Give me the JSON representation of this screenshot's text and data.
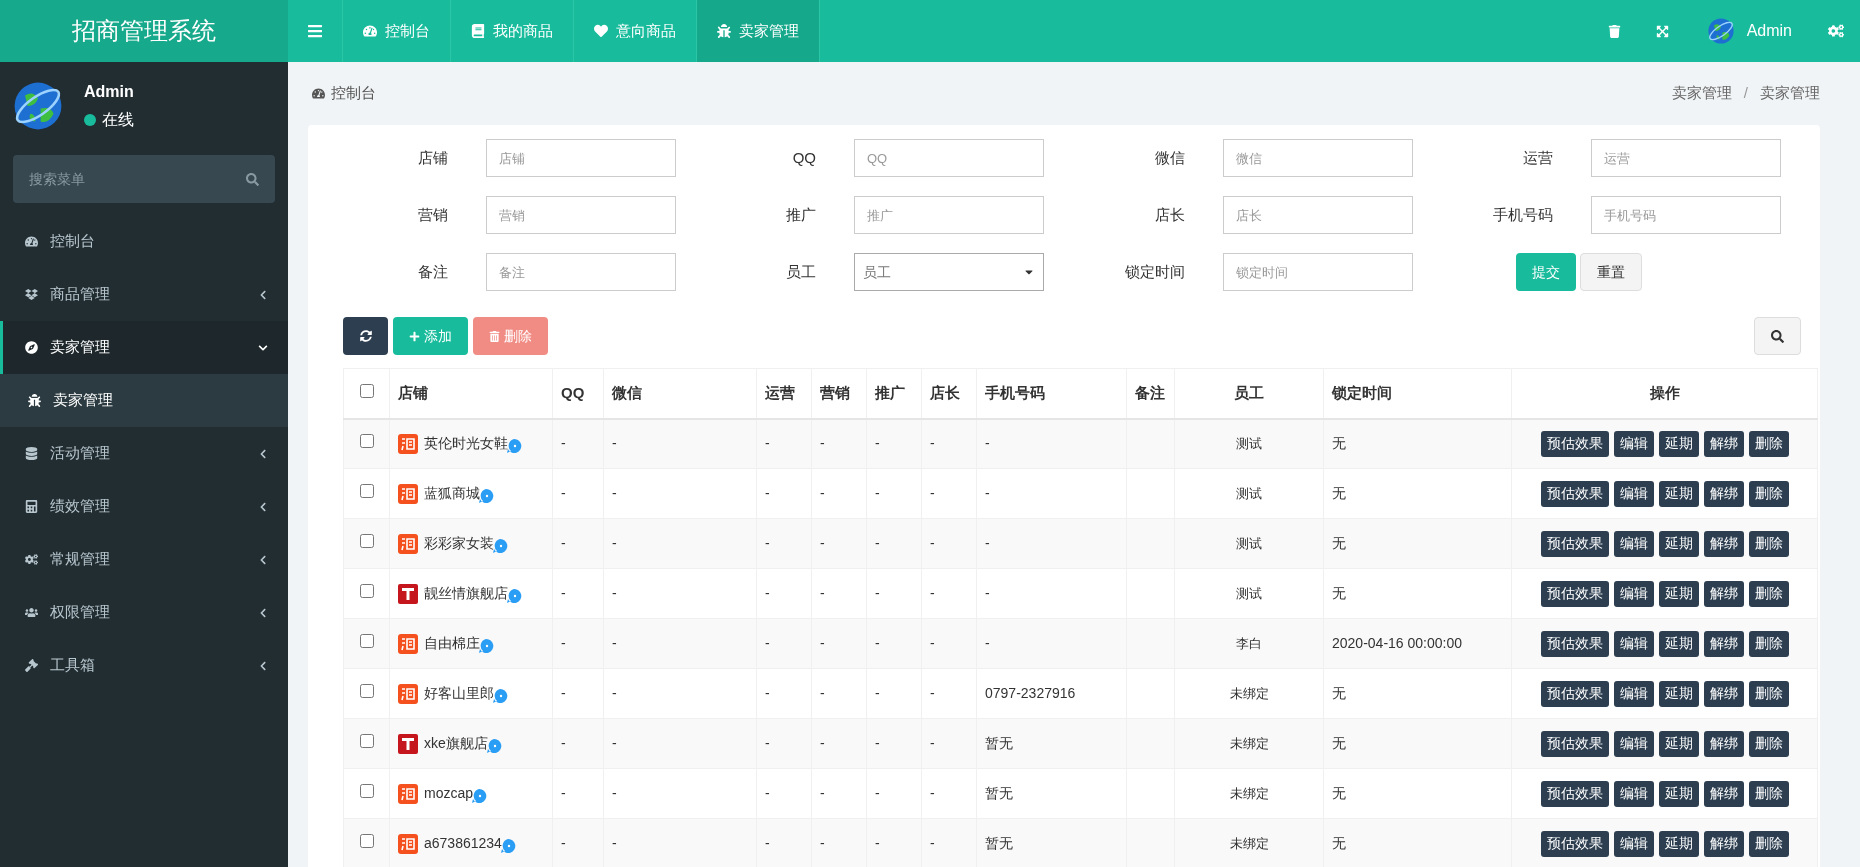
{
  "header": {
    "brand": "招商管理系统",
    "nav_tabs": [
      {
        "label": "控制台",
        "selected": false
      },
      {
        "label": "我的商品",
        "selected": false
      },
      {
        "label": "意向商品",
        "selected": false
      },
      {
        "label": "卖家管理",
        "selected": true
      }
    ],
    "user_name": "Admin"
  },
  "sidebar": {
    "user": {
      "name": "Admin",
      "status": "在线",
      "online": true
    },
    "search": {
      "placeholder": "搜索菜单"
    },
    "menu": [
      {
        "label": "控制台",
        "kind": "link",
        "selected": false
      },
      {
        "label": "商品管理",
        "kind": "group",
        "expanded": false,
        "selected": false
      },
      {
        "label": "卖家管理",
        "kind": "group",
        "expanded": true,
        "selected": true,
        "children": [
          {
            "label": "卖家管理",
            "selected": true
          }
        ]
      },
      {
        "label": "活动管理",
        "kind": "group",
        "expanded": false,
        "selected": false
      },
      {
        "label": "绩效管理",
        "kind": "group",
        "expanded": false,
        "selected": false
      },
      {
        "label": "常规管理",
        "kind": "group",
        "expanded": false,
        "selected": false
      },
      {
        "label": "权限管理",
        "kind": "group",
        "expanded": false,
        "selected": false
      },
      {
        "label": "工具箱",
        "kind": "group",
        "expanded": false,
        "selected": false
      }
    ]
  },
  "page": {
    "title": "控制台",
    "breadcrumb": [
      "卖家管理",
      "卖家管理"
    ],
    "breadcrumb_separator": "/"
  },
  "filters": {
    "fields": [
      {
        "label": "店铺",
        "placeholder": "店铺",
        "kind": "text"
      },
      {
        "label": "QQ",
        "placeholder": "QQ",
        "kind": "text"
      },
      {
        "label": "微信",
        "placeholder": "微信",
        "kind": "text"
      },
      {
        "label": "运营",
        "placeholder": "运营",
        "kind": "text"
      },
      {
        "label": "营销",
        "placeholder": "营销",
        "kind": "text"
      },
      {
        "label": "推广",
        "placeholder": "推广",
        "kind": "text"
      },
      {
        "label": "店长",
        "placeholder": "店长",
        "kind": "text"
      },
      {
        "label": "手机号码",
        "placeholder": "手机号码",
        "kind": "text"
      },
      {
        "label": "备注",
        "placeholder": "备注",
        "kind": "text"
      },
      {
        "label": "员工",
        "placeholder": "员工",
        "kind": "select"
      },
      {
        "label": "锁定时间",
        "placeholder": "锁定时间",
        "kind": "text"
      }
    ],
    "submit": "提交",
    "reset": "重置"
  },
  "toolbar": {
    "add": "添加",
    "delete": "删除"
  },
  "table": {
    "select_all": false,
    "columns": [
      "店铺",
      "QQ",
      "微信",
      "运营",
      "营销",
      "推广",
      "店长",
      "手机号码",
      "备注",
      "员工",
      "锁定时间",
      "操作"
    ],
    "rows": [
      {
        "checked": false,
        "kind": "taobao",
        "cells": [
          "英伦时光女鞋",
          "-",
          "-",
          "-",
          "-",
          "-",
          "-",
          "-",
          "",
          "测试",
          "无"
        ],
        "actions": [
          "预估效果",
          "编辑",
          "延期",
          "解绑",
          "删除"
        ]
      },
      {
        "checked": false,
        "kind": "taobao",
        "cells": [
          "蓝狐商城",
          "-",
          "-",
          "-",
          "-",
          "-",
          "-",
          "-",
          "",
          "测试",
          "无"
        ],
        "actions": [
          "预估效果",
          "编辑",
          "延期",
          "解绑",
          "删除"
        ]
      },
      {
        "checked": false,
        "kind": "taobao",
        "cells": [
          "彩彩家女装",
          "-",
          "-",
          "-",
          "-",
          "-",
          "-",
          "-",
          "",
          "测试",
          "无"
        ],
        "actions": [
          "预估效果",
          "编辑",
          "延期",
          "解绑",
          "删除"
        ]
      },
      {
        "checked": false,
        "kind": "tmall",
        "cells": [
          "靓丝情旗舰店",
          "-",
          "-",
          "-",
          "-",
          "-",
          "-",
          "-",
          "",
          "测试",
          "无"
        ],
        "actions": [
          "预估效果",
          "编辑",
          "延期",
          "解绑",
          "删除"
        ]
      },
      {
        "checked": false,
        "kind": "taobao",
        "cells": [
          "自由棉庄",
          "-",
          "-",
          "-",
          "-",
          "-",
          "-",
          "-",
          "",
          "李白",
          "2020-04-16 00:00:00"
        ],
        "actions": [
          "预估效果",
          "编辑",
          "延期",
          "解绑",
          "删除"
        ]
      },
      {
        "checked": false,
        "kind": "taobao",
        "cells": [
          "好客山里郎",
          "-",
          "-",
          "-",
          "-",
          "-",
          "-",
          "0797-2327916",
          "",
          "未绑定",
          "无"
        ],
        "actions": [
          "预估效果",
          "编辑",
          "延期",
          "解绑",
          "删除"
        ]
      },
      {
        "checked": false,
        "kind": "tmall",
        "cells": [
          "xke旗舰店",
          "-",
          "-",
          "-",
          "-",
          "-",
          "-",
          "暂无",
          "",
          "未绑定",
          "无"
        ],
        "actions": [
          "预估效果",
          "编辑",
          "延期",
          "解绑",
          "删除"
        ]
      },
      {
        "checked": false,
        "kind": "taobao",
        "cells": [
          "mozcap",
          "-",
          "-",
          "-",
          "-",
          "-",
          "-",
          "暂无",
          "",
          "未绑定",
          "无"
        ],
        "actions": [
          "预估效果",
          "编辑",
          "延期",
          "解绑",
          "删除"
        ]
      },
      {
        "checked": false,
        "kind": "taobao",
        "cells": [
          "a673861234",
          "-",
          "-",
          "-",
          "-",
          "-",
          "-",
          "暂无",
          "",
          "未绑定",
          "无"
        ],
        "actions": [
          "预估效果",
          "编辑",
          "延期",
          "解绑",
          "删除"
        ]
      }
    ]
  }
}
